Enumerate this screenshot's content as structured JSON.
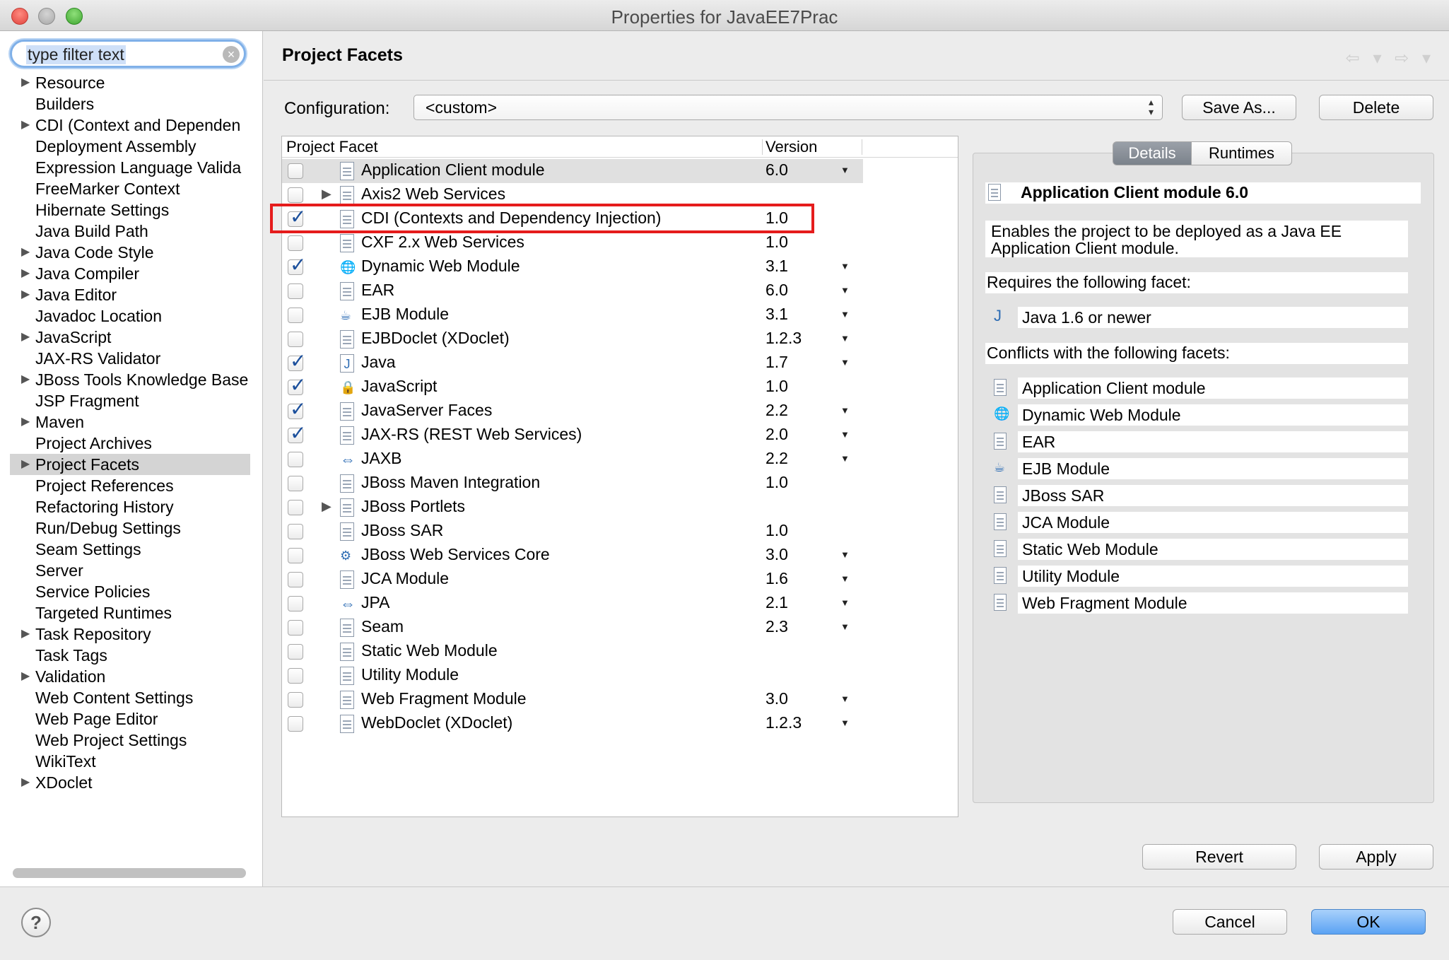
{
  "window": {
    "title": "Properties for JavaEE7Prac"
  },
  "filter": {
    "placeholder": "type filter text",
    "clear_icon": "×"
  },
  "sidebar": {
    "items": [
      {
        "label": "Resource",
        "expandable": true
      },
      {
        "label": "Builders",
        "expandable": false
      },
      {
        "label": "CDI (Context and Dependen",
        "expandable": true
      },
      {
        "label": "Deployment Assembly",
        "expandable": false
      },
      {
        "label": "Expression Language Valida",
        "expandable": false
      },
      {
        "label": "FreeMarker Context",
        "expandable": false
      },
      {
        "label": "Hibernate Settings",
        "expandable": false
      },
      {
        "label": "Java Build Path",
        "expandable": false
      },
      {
        "label": "Java Code Style",
        "expandable": true
      },
      {
        "label": "Java Compiler",
        "expandable": true
      },
      {
        "label": "Java Editor",
        "expandable": true
      },
      {
        "label": "Javadoc Location",
        "expandable": false
      },
      {
        "label": "JavaScript",
        "expandable": true
      },
      {
        "label": "JAX-RS Validator",
        "expandable": false
      },
      {
        "label": "JBoss Tools Knowledge Base",
        "expandable": true
      },
      {
        "label": "JSP Fragment",
        "expandable": false
      },
      {
        "label": "Maven",
        "expandable": true
      },
      {
        "label": "Project Archives",
        "expandable": false
      },
      {
        "label": "Project Facets",
        "expandable": true,
        "selected": true
      },
      {
        "label": "Project References",
        "expandable": false
      },
      {
        "label": "Refactoring History",
        "expandable": false
      },
      {
        "label": "Run/Debug Settings",
        "expandable": false
      },
      {
        "label": "Seam Settings",
        "expandable": false
      },
      {
        "label": "Server",
        "expandable": false
      },
      {
        "label": "Service Policies",
        "expandable": false
      },
      {
        "label": "Targeted Runtimes",
        "expandable": false
      },
      {
        "label": "Task Repository",
        "expandable": true
      },
      {
        "label": "Task Tags",
        "expandable": false
      },
      {
        "label": "Validation",
        "expandable": true
      },
      {
        "label": "Web Content Settings",
        "expandable": false
      },
      {
        "label": "Web Page Editor",
        "expandable": false
      },
      {
        "label": "Web Project Settings",
        "expandable": false
      },
      {
        "label": "WikiText",
        "expandable": false
      },
      {
        "label": "XDoclet",
        "expandable": true
      }
    ]
  },
  "page": {
    "title": "Project Facets",
    "nav_arrows": "⇦ ▾ ⇨ ▾"
  },
  "config": {
    "label": "Configuration:",
    "value": "<custom>",
    "save_as_label": "Save As...",
    "delete_label": "Delete"
  },
  "facet_table": {
    "col_facet": "Project Facet",
    "col_version": "Version",
    "rows": [
      {
        "name": "Application Client module",
        "version": "6.0",
        "checked": false,
        "dropdown": true,
        "expander": false,
        "icon": "doc",
        "selected": true
      },
      {
        "name": "Axis2 Web Services",
        "version": "",
        "checked": false,
        "dropdown": false,
        "expander": true,
        "icon": "doc"
      },
      {
        "name": "CDI (Contexts and Dependency Injection)",
        "version": "1.0",
        "checked": true,
        "dropdown": false,
        "expander": false,
        "icon": "doc",
        "highlighted": true
      },
      {
        "name": "CXF 2.x Web Services",
        "version": "1.0",
        "checked": false,
        "dropdown": false,
        "expander": false,
        "icon": "doc"
      },
      {
        "name": "Dynamic Web Module",
        "version": "3.1",
        "checked": true,
        "dropdown": true,
        "expander": false,
        "icon": "globe"
      },
      {
        "name": "EAR",
        "version": "6.0",
        "checked": false,
        "dropdown": true,
        "expander": false,
        "icon": "doc"
      },
      {
        "name": "EJB Module",
        "version": "3.1",
        "checked": false,
        "dropdown": true,
        "expander": false,
        "icon": "bean"
      },
      {
        "name": "EJBDoclet (XDoclet)",
        "version": "1.2.3",
        "checked": false,
        "dropdown": true,
        "expander": false,
        "icon": "doc"
      },
      {
        "name": "Java",
        "version": "1.7",
        "checked": true,
        "dropdown": true,
        "expander": false,
        "icon": "java"
      },
      {
        "name": "JavaScript",
        "version": "1.0",
        "checked": true,
        "dropdown": false,
        "expander": false,
        "icon": "lock"
      },
      {
        "name": "JavaServer Faces",
        "version": "2.2",
        "checked": true,
        "dropdown": true,
        "expander": false,
        "icon": "doc"
      },
      {
        "name": "JAX-RS (REST Web Services)",
        "version": "2.0",
        "checked": true,
        "dropdown": true,
        "expander": false,
        "icon": "doc"
      },
      {
        "name": "JAXB",
        "version": "2.2",
        "checked": false,
        "dropdown": true,
        "expander": false,
        "icon": "arrows"
      },
      {
        "name": "JBoss Maven Integration",
        "version": "1.0",
        "checked": false,
        "dropdown": false,
        "expander": false,
        "icon": "doc"
      },
      {
        "name": "JBoss Portlets",
        "version": "",
        "checked": false,
        "dropdown": false,
        "expander": true,
        "icon": "doc"
      },
      {
        "name": "JBoss SAR",
        "version": "1.0",
        "checked": false,
        "dropdown": false,
        "expander": false,
        "icon": "doc"
      },
      {
        "name": "JBoss Web Services Core",
        "version": "3.0",
        "checked": false,
        "dropdown": true,
        "expander": false,
        "icon": "gear"
      },
      {
        "name": "JCA Module",
        "version": "1.6",
        "checked": false,
        "dropdown": true,
        "expander": false,
        "icon": "doc"
      },
      {
        "name": "JPA",
        "version": "2.1",
        "checked": false,
        "dropdown": true,
        "expander": false,
        "icon": "arrows"
      },
      {
        "name": "Seam",
        "version": "2.3",
        "checked": false,
        "dropdown": true,
        "expander": false,
        "icon": "doc"
      },
      {
        "name": "Static Web Module",
        "version": "",
        "checked": false,
        "dropdown": false,
        "expander": false,
        "icon": "doc"
      },
      {
        "name": "Utility Module",
        "version": "",
        "checked": false,
        "dropdown": false,
        "expander": false,
        "icon": "doc"
      },
      {
        "name": "Web Fragment Module",
        "version": "3.0",
        "checked": false,
        "dropdown": true,
        "expander": false,
        "icon": "doc"
      },
      {
        "name": "WebDoclet (XDoclet)",
        "version": "1.2.3",
        "checked": false,
        "dropdown": true,
        "expander": false,
        "icon": "doc"
      }
    ]
  },
  "details": {
    "tab_details": "Details",
    "tab_runtimes": "Runtimes",
    "title": "Application Client module 6.0",
    "description_line1": "Enables the project to be deployed as a Java EE",
    "description_line2": "Application Client module.",
    "requires_label": "Requires the following facet:",
    "requires_item": "Java 1.6 or newer",
    "conflicts_label": "Conflicts with the following facets:",
    "conflicts": [
      {
        "name": "Application Client module",
        "icon": "doc"
      },
      {
        "name": "Dynamic Web Module",
        "icon": "globe"
      },
      {
        "name": "EAR",
        "icon": "doc"
      },
      {
        "name": "EJB Module",
        "icon": "bean"
      },
      {
        "name": "JBoss SAR",
        "icon": "doc"
      },
      {
        "name": "JCA Module",
        "icon": "doc"
      },
      {
        "name": "Static Web Module",
        "icon": "doc"
      },
      {
        "name": "Utility Module",
        "icon": "doc"
      },
      {
        "name": "Web Fragment Module",
        "icon": "doc"
      }
    ]
  },
  "buttons": {
    "revert": "Revert",
    "apply": "Apply",
    "cancel": "Cancel",
    "ok": "OK",
    "help": "?"
  },
  "colors": {
    "highlight_border": "#e51c1c",
    "check_blue": "#1b4f9c",
    "ok_button": "#5aa2f3"
  }
}
